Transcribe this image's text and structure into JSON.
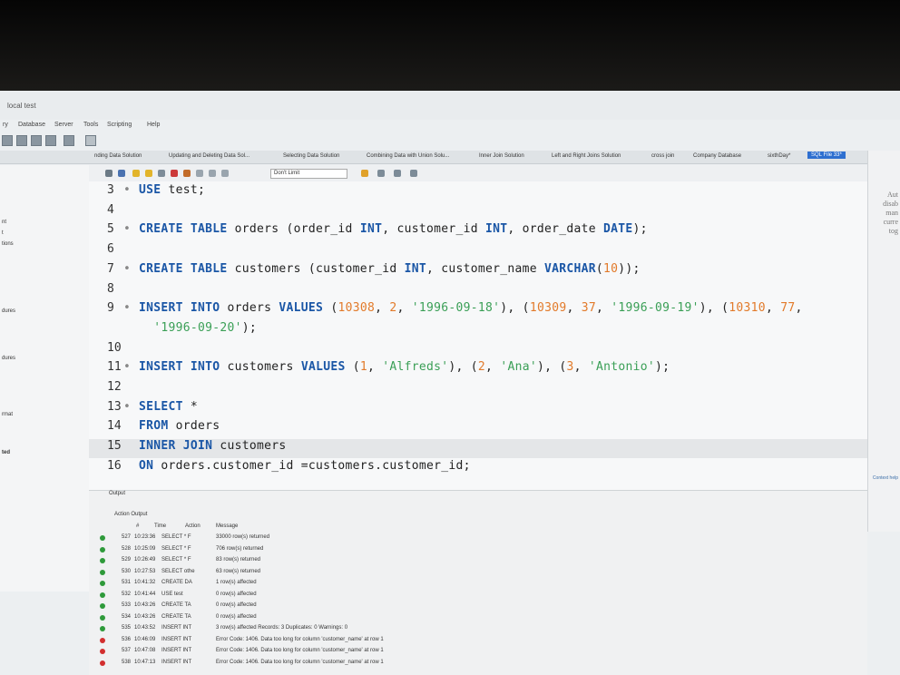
{
  "window": {
    "title": "local test"
  },
  "menu": [
    "ry",
    "Database",
    "Server",
    "Tools",
    "Scripting",
    "Help"
  ],
  "tabs": [
    {
      "label": "nding Data Solution"
    },
    {
      "label": "Updating and Deleting Data Sol..."
    },
    {
      "label": "Selecting Data Solution"
    },
    {
      "label": "Combining Data with Union Solu..."
    },
    {
      "label": "Inner Join Solution"
    },
    {
      "label": "Left and Right Joins Solution"
    },
    {
      "label": "cross join"
    },
    {
      "label": "Company Database"
    },
    {
      "label": "sixthDay*"
    },
    {
      "label": "SQL File 33*",
      "active": true
    }
  ],
  "query_toolbar": {
    "limit_value": "Don't Limit"
  },
  "sidebar": {
    "items": [
      "nt",
      "t",
      "tions",
      "dures",
      "dures",
      "rmat",
      "ted"
    ]
  },
  "editor": {
    "lines": [
      {
        "n": "3",
        "dot": "•",
        "segments": [
          {
            "t": "USE",
            "c": "kw"
          },
          {
            "t": " test;",
            "c": ""
          }
        ]
      },
      {
        "n": "4",
        "dot": "",
        "segments": []
      },
      {
        "n": "5",
        "dot": "•",
        "segments": [
          {
            "t": "CREATE TABLE",
            "c": "kw"
          },
          {
            "t": " orders (order_id ",
            "c": ""
          },
          {
            "t": "INT",
            "c": "kw"
          },
          {
            "t": ", customer_id ",
            "c": ""
          },
          {
            "t": "INT",
            "c": "kw"
          },
          {
            "t": ", order_date ",
            "c": ""
          },
          {
            "t": "DATE",
            "c": "kw"
          },
          {
            "t": ");",
            "c": ""
          }
        ]
      },
      {
        "n": "6",
        "dot": "",
        "segments": []
      },
      {
        "n": "7",
        "dot": "•",
        "segments": [
          {
            "t": "CREATE TABLE",
            "c": "kw"
          },
          {
            "t": " customers (customer_id ",
            "c": ""
          },
          {
            "t": "INT",
            "c": "kw"
          },
          {
            "t": ", customer_name ",
            "c": ""
          },
          {
            "t": "VARCHAR",
            "c": "kw"
          },
          {
            "t": "(",
            "c": ""
          },
          {
            "t": "10",
            "c": "num"
          },
          {
            "t": "));",
            "c": ""
          }
        ]
      },
      {
        "n": "8",
        "dot": "",
        "segments": []
      },
      {
        "n": "9",
        "dot": "•",
        "segments": [
          {
            "t": "INSERT INTO",
            "c": "kw"
          },
          {
            "t": " orders ",
            "c": ""
          },
          {
            "t": "VALUES",
            "c": "kw"
          },
          {
            "t": " (",
            "c": ""
          },
          {
            "t": "10308",
            "c": "num"
          },
          {
            "t": ", ",
            "c": ""
          },
          {
            "t": "2",
            "c": "num"
          },
          {
            "t": ", ",
            "c": ""
          },
          {
            "t": "'1996-09-18'",
            "c": "str"
          },
          {
            "t": "), (",
            "c": ""
          },
          {
            "t": "10309",
            "c": "num"
          },
          {
            "t": ", ",
            "c": ""
          },
          {
            "t": "37",
            "c": "num"
          },
          {
            "t": ", ",
            "c": ""
          },
          {
            "t": "'1996-09-19'",
            "c": "str"
          },
          {
            "t": "), (",
            "c": ""
          },
          {
            "t": "10310",
            "c": "num"
          },
          {
            "t": ", ",
            "c": ""
          },
          {
            "t": "77",
            "c": "num"
          },
          {
            "t": ",",
            "c": ""
          }
        ]
      },
      {
        "n": "",
        "dot": "",
        "segments": [
          {
            "t": "  ",
            "c": ""
          },
          {
            "t": "'1996-09-20'",
            "c": "str"
          },
          {
            "t": ");",
            "c": ""
          }
        ]
      },
      {
        "n": "10",
        "dot": "",
        "segments": []
      },
      {
        "n": "11",
        "dot": "•",
        "segments": [
          {
            "t": "INSERT INTO",
            "c": "kw"
          },
          {
            "t": " customers ",
            "c": ""
          },
          {
            "t": "VALUES",
            "c": "kw"
          },
          {
            "t": " (",
            "c": ""
          },
          {
            "t": "1",
            "c": "num"
          },
          {
            "t": ", ",
            "c": ""
          },
          {
            "t": "'Alfreds'",
            "c": "str"
          },
          {
            "t": "), (",
            "c": ""
          },
          {
            "t": "2",
            "c": "num"
          },
          {
            "t": ", ",
            "c": ""
          },
          {
            "t": "'Ana'",
            "c": "str"
          },
          {
            "t": "), (",
            "c": ""
          },
          {
            "t": "3",
            "c": "num"
          },
          {
            "t": ", ",
            "c": ""
          },
          {
            "t": "'Antonio'",
            "c": "str"
          },
          {
            "t": ");",
            "c": ""
          }
        ]
      },
      {
        "n": "12",
        "dot": "",
        "segments": []
      },
      {
        "n": "13",
        "dot": "•",
        "segments": [
          {
            "t": "SELECT",
            "c": "kw"
          },
          {
            "t": " *",
            "c": ""
          }
        ]
      },
      {
        "n": "14",
        "dot": "",
        "segments": [
          {
            "t": "FROM",
            "c": "kw"
          },
          {
            "t": " orders",
            "c": ""
          }
        ]
      },
      {
        "n": "15",
        "dot": "",
        "segments": [
          {
            "t": "INNER JOIN",
            "c": "kw"
          },
          {
            "t": " customers",
            "c": ""
          }
        ]
      },
      {
        "n": "16",
        "dot": "",
        "segments": [
          {
            "t": "ON",
            "c": "kw"
          },
          {
            "t": " orders.customer_id =customers.customer_id;",
            "c": ""
          }
        ]
      }
    ]
  },
  "right_panel": {
    "lines": [
      "Aut",
      "disab",
      "man",
      "curre",
      "tog"
    ],
    "footer": "Context help"
  },
  "output": {
    "title": "Output",
    "selector": "Action Output",
    "headers": {
      "num": "#",
      "time": "Time",
      "action": "Action",
      "message": "Message"
    },
    "rows": [
      {
        "status": "ok",
        "num": "527",
        "time": "10:23:36",
        "action": "SELECT * F",
        "message": "33000 row(s) returned"
      },
      {
        "status": "ok",
        "num": "528",
        "time": "10:25:09",
        "action": "SELECT * F",
        "message": "706 row(s) returned"
      },
      {
        "status": "ok",
        "num": "529",
        "time": "10:26:49",
        "action": "SELECT * F",
        "message": "83 row(s) returned"
      },
      {
        "status": "ok",
        "num": "530",
        "time": "10:27:53",
        "action": "SELECT othe",
        "message": "63 row(s) returned"
      },
      {
        "status": "ok",
        "num": "531",
        "time": "10:41:32",
        "action": "CREATE DA",
        "message": "1 row(s) affected"
      },
      {
        "status": "ok",
        "num": "532",
        "time": "10:41:44",
        "action": "USE test",
        "message": "0 row(s) affected"
      },
      {
        "status": "ok",
        "num": "533",
        "time": "10:43:26",
        "action": "CREATE TA",
        "message": "0 row(s) affected"
      },
      {
        "status": "ok",
        "num": "534",
        "time": "10:43:26",
        "action": "CREATE TA",
        "message": "0 row(s) affected"
      },
      {
        "status": "ok",
        "num": "535",
        "time": "10:43:52",
        "action": "INSERT INT",
        "message": "3 row(s) affected Records: 3  Duplicates: 0  Warnings: 0"
      },
      {
        "status": "err",
        "num": "536",
        "time": "10:46:09",
        "action": "INSERT INT",
        "message": "Error Code: 1406. Data too long for column 'customer_name' at row 1"
      },
      {
        "status": "err",
        "num": "537",
        "time": "10:47:08",
        "action": "INSERT INT",
        "message": "Error Code: 1406. Data too long for column 'customer_name' at row 1"
      },
      {
        "status": "err",
        "num": "538",
        "time": "10:47:13",
        "action": "INSERT INT",
        "message": "Error Code: 1406. Data too long for column 'customer_name' at row 1"
      }
    ]
  }
}
